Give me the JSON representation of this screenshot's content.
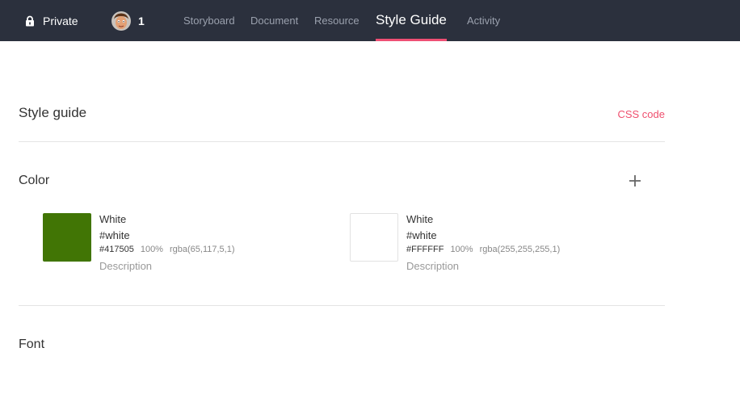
{
  "topbar": {
    "privacy_label": "Private",
    "member_count": "1",
    "accent_color": "#ef4f74",
    "tabs": [
      {
        "label": "Storyboard",
        "active": false
      },
      {
        "label": "Document",
        "active": false
      },
      {
        "label": "Resource",
        "active": false
      },
      {
        "label": "Style Guide",
        "active": true
      },
      {
        "label": "Activity",
        "active": false
      }
    ]
  },
  "main": {
    "title": "Style guide",
    "css_link": "CSS code",
    "color_section": {
      "title": "Color",
      "add_icon": "plus-icon",
      "colors": [
        {
          "name": "White",
          "variable": "#white",
          "hex": "#417505",
          "opacity": "100%",
          "rgba": "rgba(65,117,5,1)",
          "description": "Description",
          "swatch": "#417505"
        },
        {
          "name": "White",
          "variable": "#white",
          "hex": "#FFFFFF",
          "opacity": "100%",
          "rgba": "rgba(255,255,255,1)",
          "description": "Description",
          "swatch": "#FFFFFF"
        }
      ]
    },
    "font_section": {
      "title": "Font"
    }
  }
}
